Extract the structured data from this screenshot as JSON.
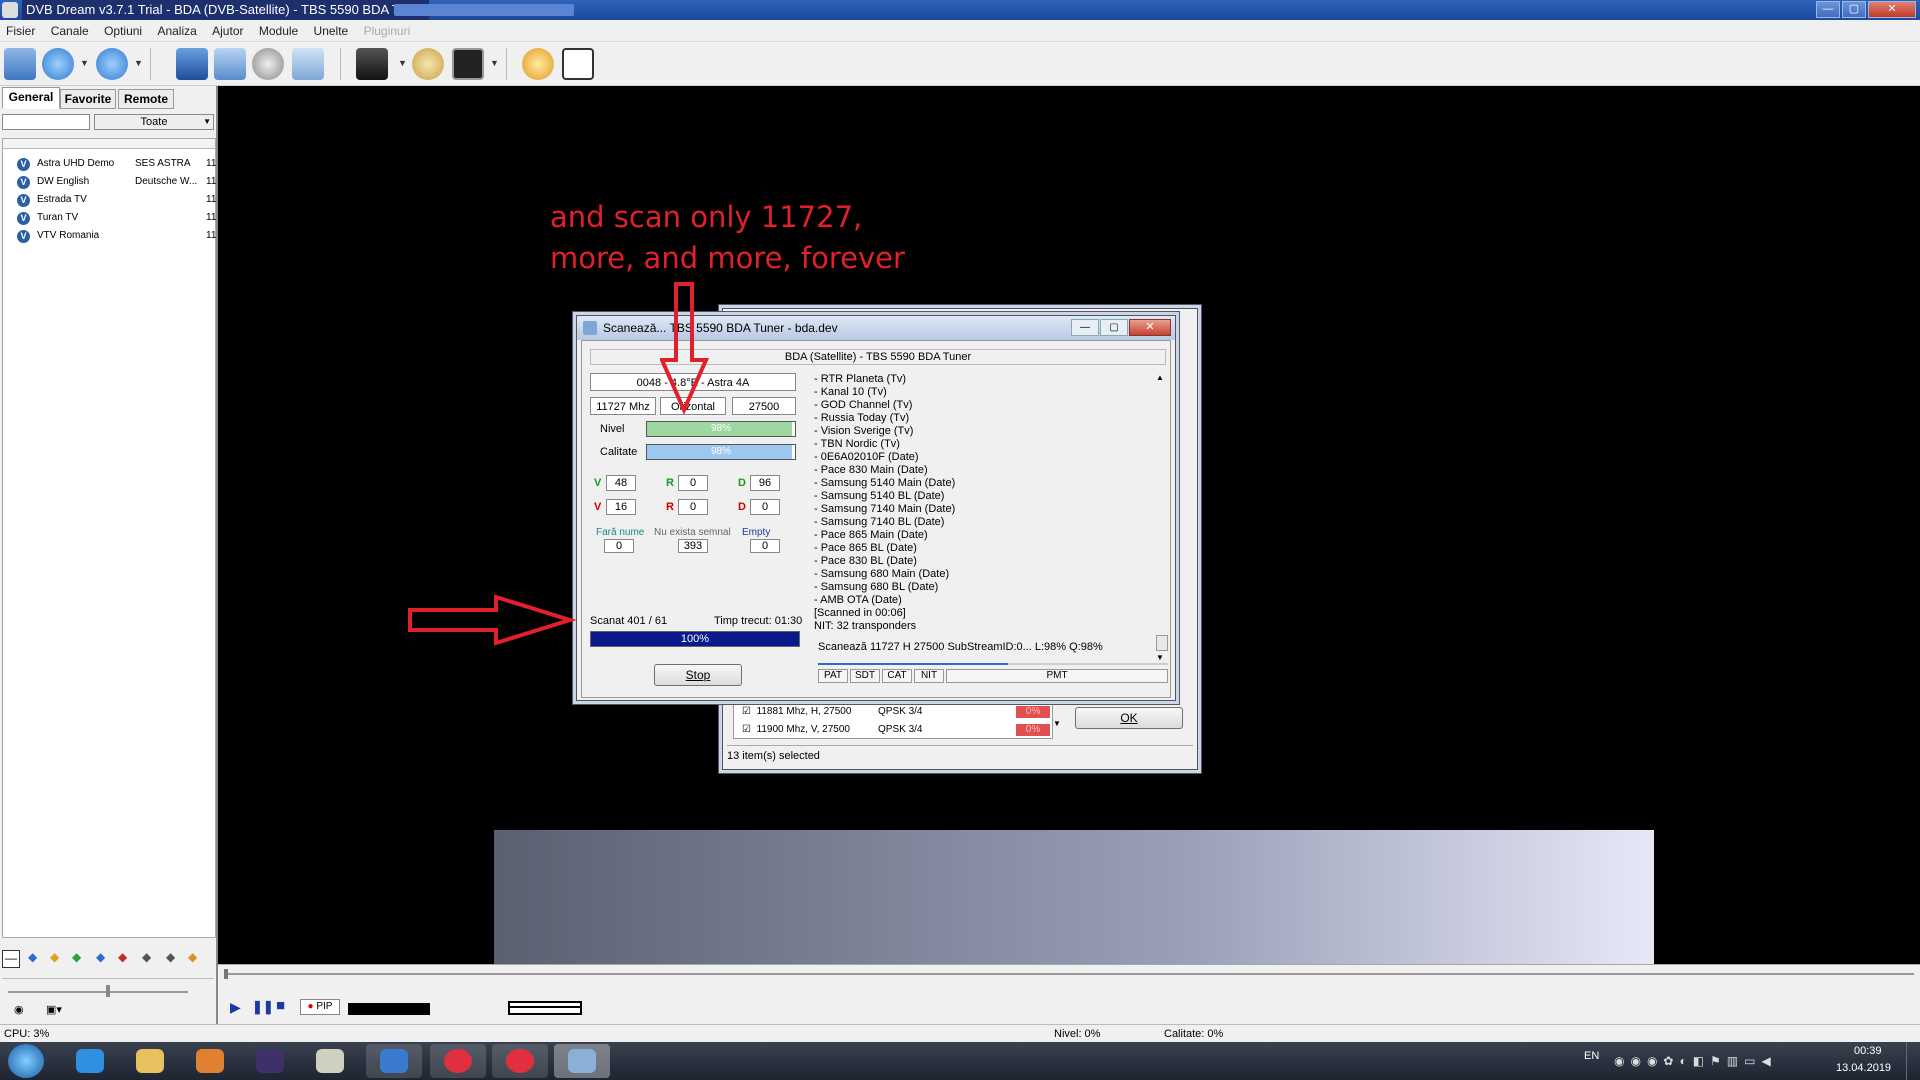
{
  "titlebar": {
    "title": "DVB Dream v3.7.1 Trial - BDA (DVB-Satellite)  -  TBS 5590 BDA Tuner"
  },
  "menu": [
    "Fisier",
    "Canale",
    "Optiuni",
    "Analiza",
    "Ajutor",
    "Module",
    "Unelte",
    "Pluginuri"
  ],
  "tabs": [
    "General",
    "Favorite",
    "Remote"
  ],
  "filter": {
    "value": "Toate"
  },
  "channels": [
    {
      "name": "Astra UHD Demo",
      "provider": "SES ASTRA",
      "num": "11"
    },
    {
      "name": "DW English",
      "provider": "Deutsche W...",
      "num": "11"
    },
    {
      "name": "Estrada TV",
      "provider": "",
      "num": "11"
    },
    {
      "name": "Turan TV",
      "provider": "",
      "num": "11"
    },
    {
      "name": "VTV Romania",
      "provider": "",
      "num": "11"
    }
  ],
  "annotation": {
    "line1": "and scan only 11727,",
    "line2": "more, and more, forever"
  },
  "scan": {
    "title": "Scanează...  TBS 5590 BDA Tuner - bda.dev",
    "header": "BDA (Satellite)  -  TBS 5590 BDA Tuner",
    "satellite": "0048 - 4.8°E - Astra 4A",
    "freq": "11727 Mhz",
    "pol": "Orizontal",
    "sr": "27500",
    "nivel_label": "Nivel",
    "nivel_value": "98%",
    "nivel_level": 0.98,
    "calitate_label": "Calitate",
    "calitate_value": "98%",
    "calitate_level": 0.98,
    "v1": "48",
    "r1": "0",
    "d1": "96",
    "v2": "16",
    "r2": "0",
    "d2": "0",
    "v": "V",
    "r": "R",
    "d": "D",
    "fara_nume_label": "Fară nume",
    "fara_nume": "0",
    "nu_exista_label": "Nu exista semnal",
    "nu_exista": "393",
    "empty_label": "Empty",
    "empty": "0",
    "scanat": "Scanat 401 / 61",
    "timp": "Timp trecut: 01:30",
    "progress": "100%",
    "progress_level": 1.0,
    "stop": "Stop",
    "log": [
      "- RTR Planeta (Tv)",
      "- Kanal 10 (Tv)",
      "- GOD Channel (Tv)",
      "- Russia Today (Tv)",
      "- Vision Sverige (Tv)",
      "- TBN Nordic (Tv)",
      "- 0E6A02010F (Date)",
      "- Pace 830 Main (Date)",
      "- Samsung 5140 Main (Date)",
      "- Samsung 5140 BL (Date)",
      "- Samsung 7140 Main (Date)",
      "- Samsung 7140 BL (Date)",
      "- Pace 865 Main (Date)",
      "- Pace 865 BL (Date)",
      "- Pace 830 BL (Date)",
      "- Samsung 680 Main (Date)",
      "- Samsung 680 BL (Date)",
      "- AMB OTA (Date)",
      "[Scanned in 00:06]",
      "NIT: 32 transponders"
    ],
    "current": "Scanează 11727 H 27500 SubStreamID:0... L:98% Q:98%",
    "pid_tabs": [
      "PAT",
      "SDT",
      "CAT",
      "NIT",
      "PMT"
    ]
  },
  "back": {
    "rows": [
      {
        "tp": "11881 Mhz, H, 27500",
        "mod": "QPSK 3/4",
        "pct": "0%"
      },
      {
        "tp": "11900 Mhz, V, 27500",
        "mod": "QPSK 3/4",
        "pct": "0%"
      }
    ],
    "ok": "OK",
    "status": "13 item(s) selected"
  },
  "player": {
    "pip": "PIP"
  },
  "status": {
    "cpu": "CPU: 3%",
    "nivel": "Nivel: 0%",
    "calitate": "Calitate: 0%"
  },
  "taskbar": {
    "lang": "EN",
    "time": "00:39",
    "date": "13.04.2019"
  }
}
